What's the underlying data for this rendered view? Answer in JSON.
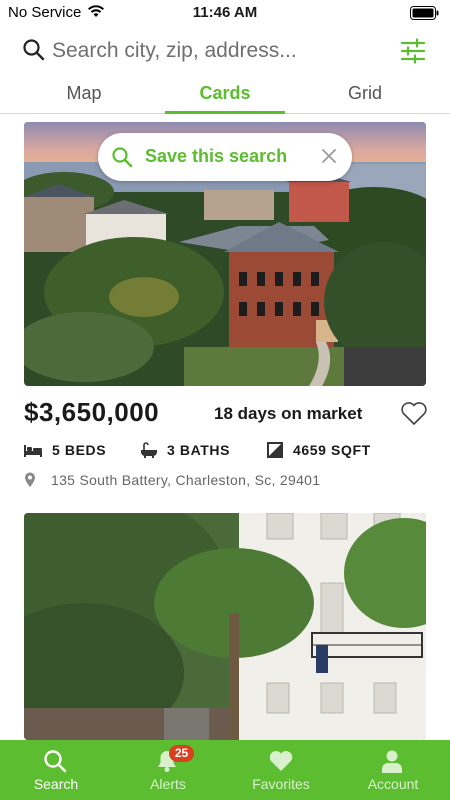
{
  "status_bar": {
    "carrier": "No Service",
    "time": "11:46 AM"
  },
  "search": {
    "placeholder": "Search city, zip, address..."
  },
  "tabs": [
    {
      "label": "Map",
      "active": false
    },
    {
      "label": "Cards",
      "active": true
    },
    {
      "label": "Grid",
      "active": false
    }
  ],
  "save_search": {
    "label": "Save this search"
  },
  "listings": [
    {
      "price": "$3,650,000",
      "days_on_market": "18 days on market",
      "beds": "5 BEDS",
      "baths": "3 BATHS",
      "sqft": "4659 SQFT",
      "address": "135 South Battery, Charleston, Sc, 29401"
    }
  ],
  "bottom_nav": {
    "search": "Search",
    "alerts": "Alerts",
    "alerts_badge": "25",
    "favorites": "Favorites",
    "account": "Account"
  },
  "colors": {
    "accent": "#5bbd2f",
    "badge": "#d9411e"
  }
}
